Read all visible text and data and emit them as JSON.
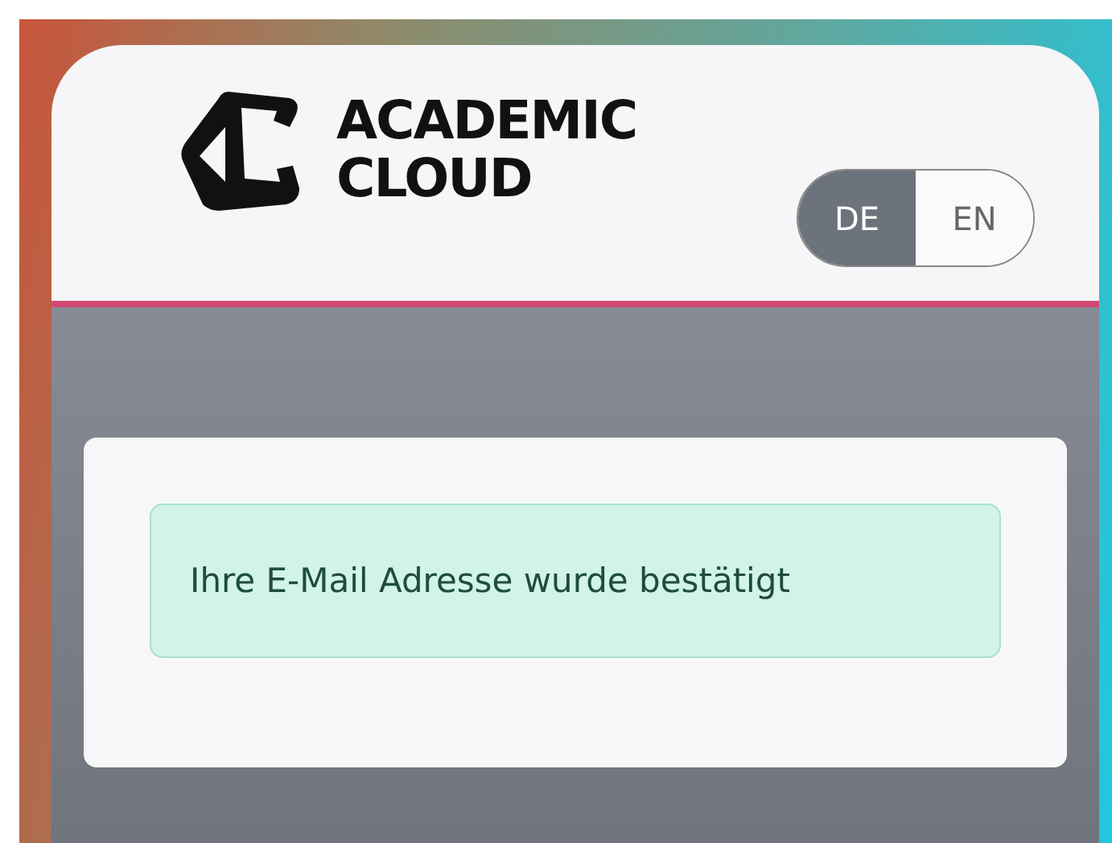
{
  "logo": {
    "lines": [
      "ACADEMIC",
      "CLOUD"
    ]
  },
  "language_toggle": [
    {
      "label": "DE",
      "selected": true
    },
    {
      "label": "EN",
      "selected": false
    }
  ],
  "message": {
    "kind": "success",
    "text": "Ihre E-Mail Adresse wurde bestätigt"
  }
}
